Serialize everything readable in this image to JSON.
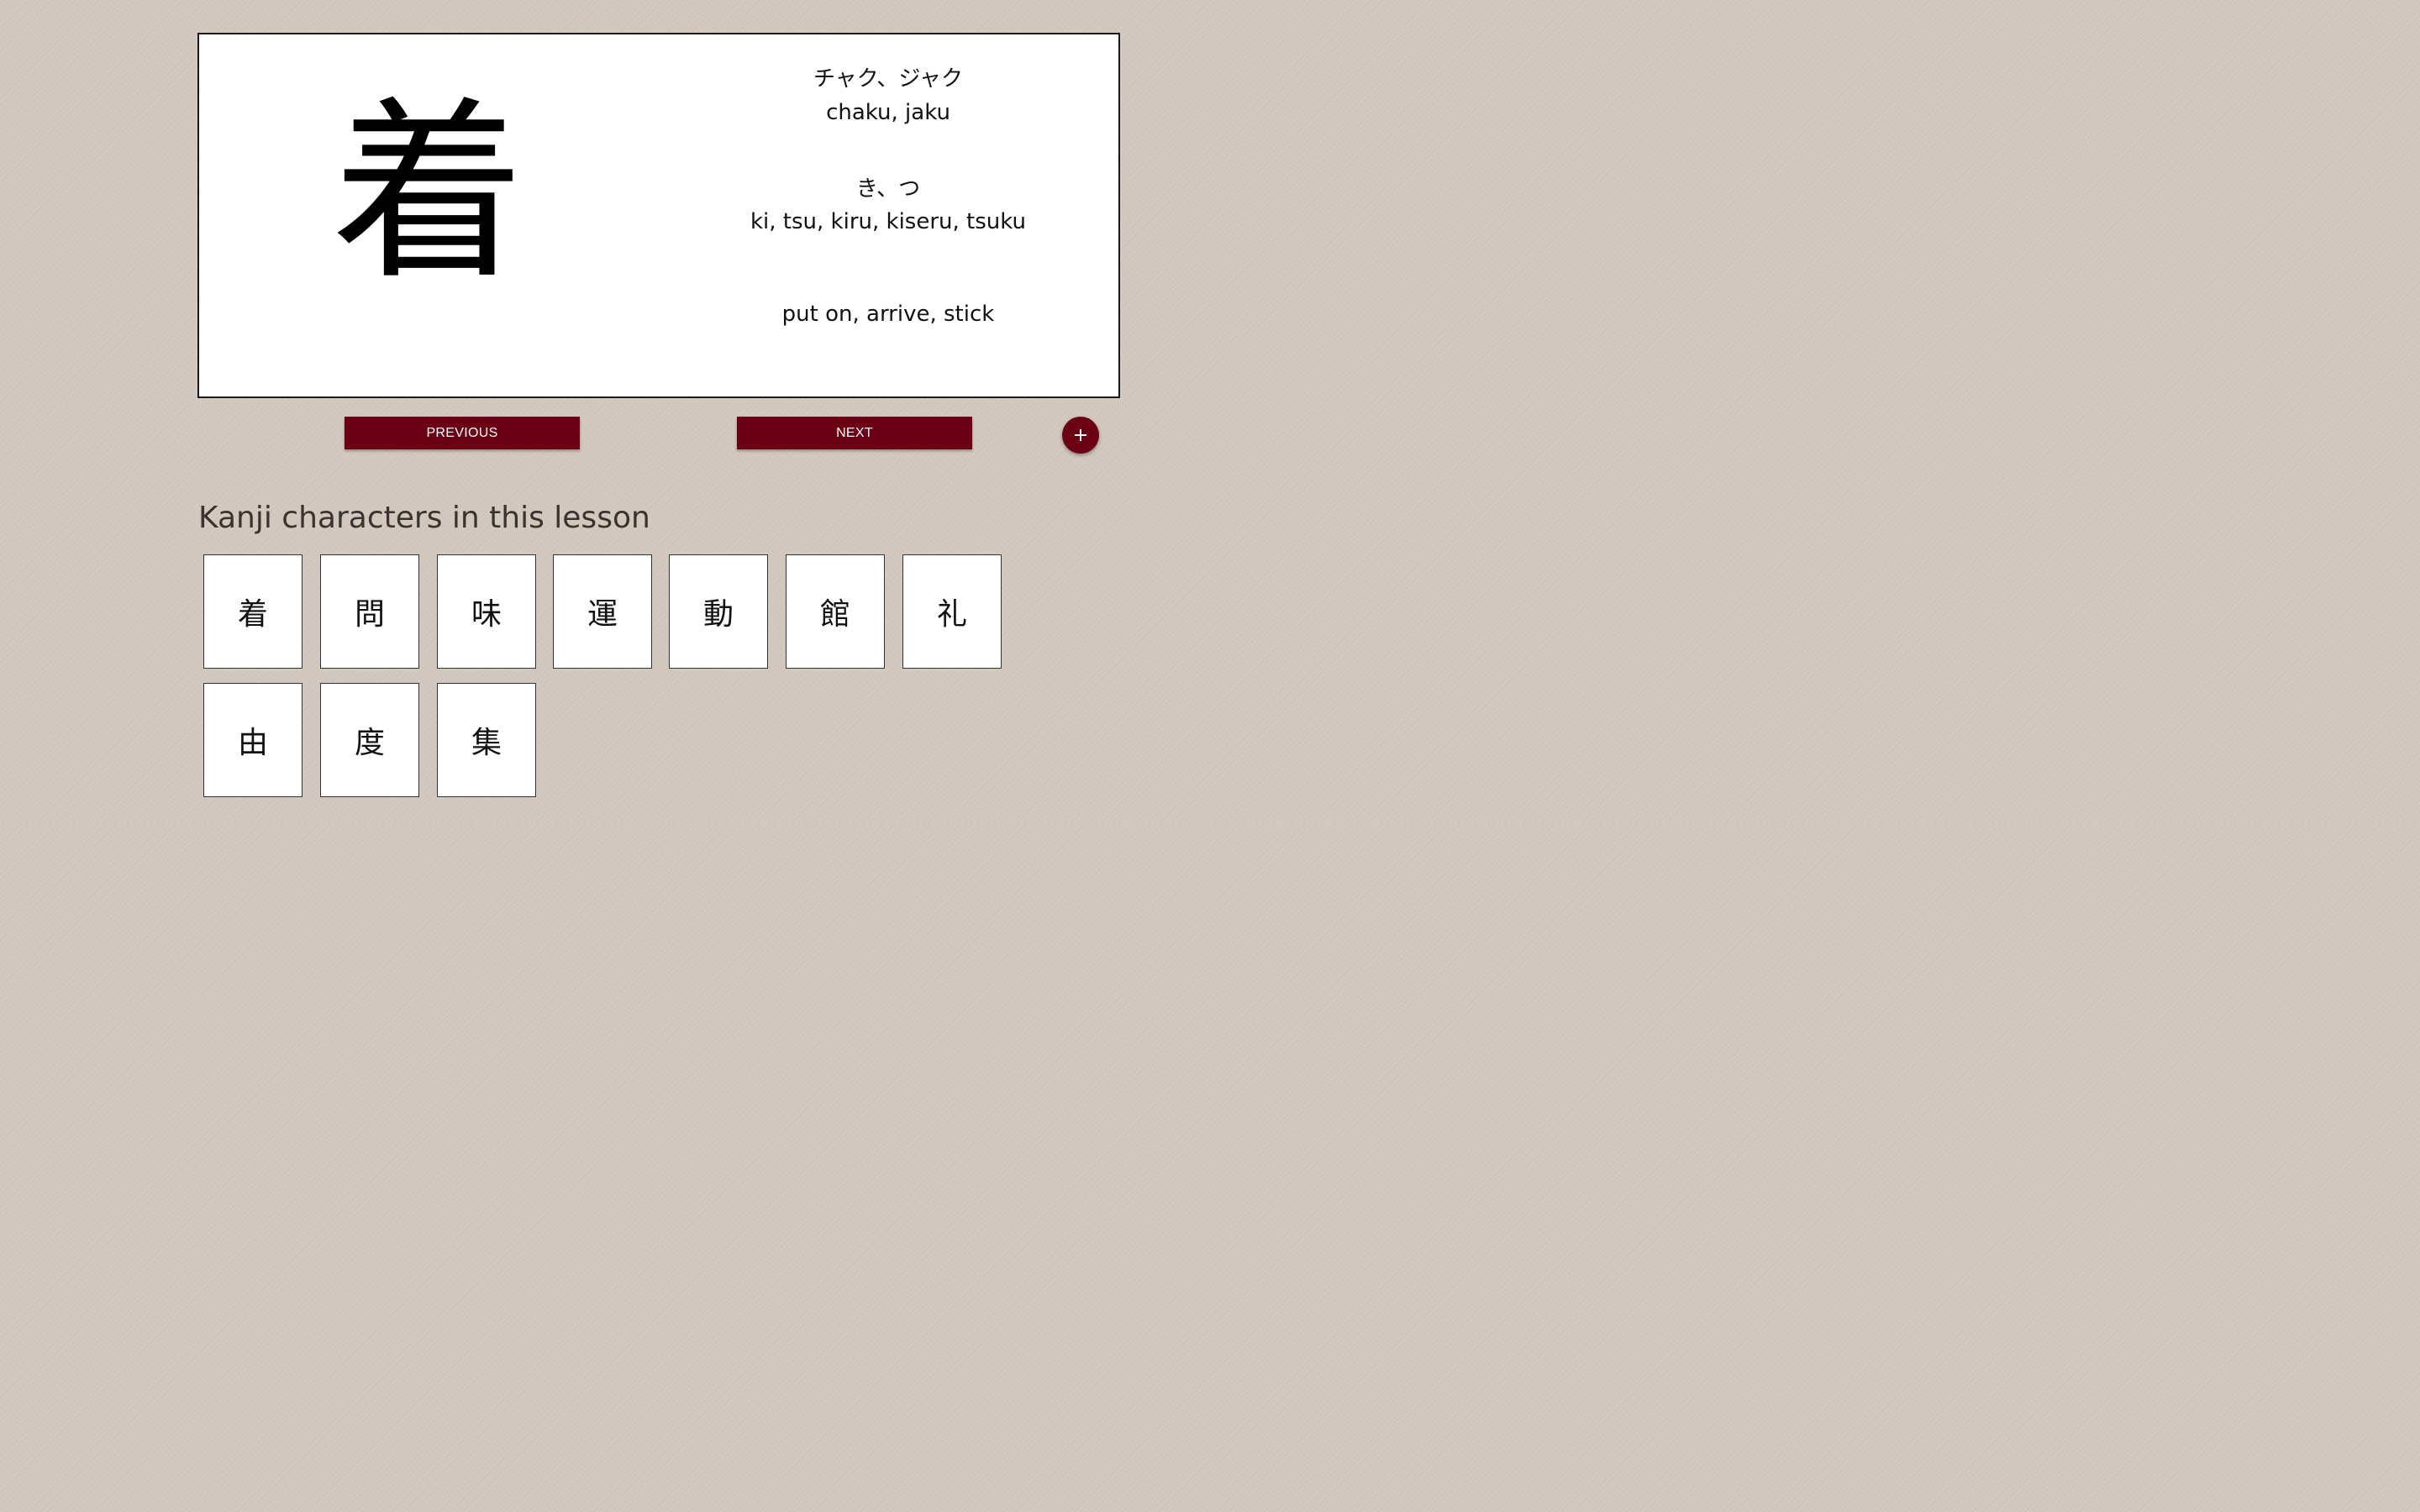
{
  "flashcard": {
    "kanji": "着",
    "on_kana": "チャク、ジャク",
    "on_romaji": "chaku, jaku",
    "kun_kana": "き、つ",
    "kun_romaji": "ki, tsu, kiru, kiseru, tsuku",
    "meaning": "put on, arrive, stick"
  },
  "controls": {
    "previous_label": "PREVIOUS",
    "next_label": "NEXT",
    "add_icon": "plus-icon"
  },
  "lesson": {
    "heading": "Kanji characters in this lesson",
    "kanji": [
      "着",
      "問",
      "味",
      "運",
      "動",
      "館",
      "礼",
      "由",
      "度",
      "集"
    ]
  },
  "colors": {
    "accent": "#6b0014",
    "background": "#d2c8be",
    "card": "#ffffff"
  }
}
